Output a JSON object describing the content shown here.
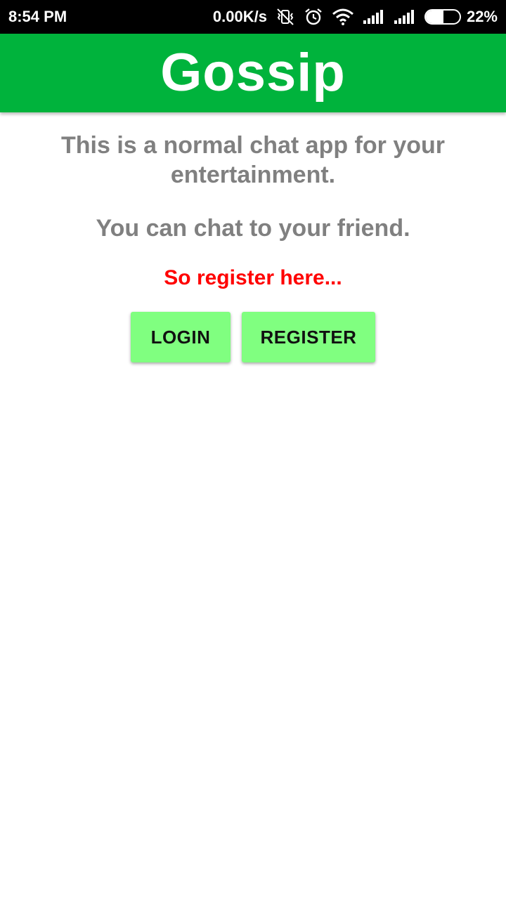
{
  "status_bar": {
    "time": "8:54 PM",
    "net_speed": "0.00K/s",
    "battery_percent_label": "22%",
    "battery_level": 0.22,
    "icons": [
      "vibrate-off-icon",
      "alarm-icon",
      "wifi-icon",
      "signal-icon",
      "signal-icon",
      "battery-icon"
    ]
  },
  "app_bar": {
    "title": "Gossip",
    "color": "#00b33c"
  },
  "main": {
    "intro": "This is a normal chat app for your entertainment.",
    "chat_line": "You can chat to your friend.",
    "cta": "So register here...",
    "cta_color": "#ff0000",
    "login_label": "LOGIN",
    "register_label": "REGISTER",
    "button_color": "#80ff80"
  }
}
